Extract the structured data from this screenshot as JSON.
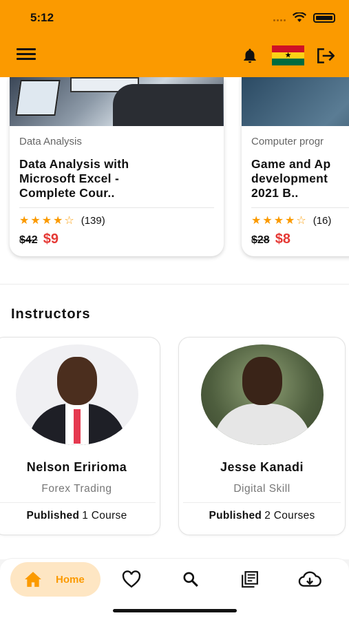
{
  "status_bar": {
    "time": "5:12"
  },
  "colors": {
    "accent": "#fb9a00",
    "price_red": "#e53935",
    "home_pill": "#fee6c3"
  },
  "header": {
    "menu_icon": "hamburger-menu-icon",
    "notification_icon": "bell-icon",
    "flag_icon": "ghana-flag-icon",
    "logout_icon": "logout-icon"
  },
  "courses": [
    {
      "category": "Data Analysis",
      "title_line1": "Data Analysis with",
      "title_line2": "Microsoft Excel -",
      "title_line3": "Complete Cour..",
      "stars": "★★★★☆",
      "rating_value": 4,
      "review_count": "(139)",
      "old_price": "$42",
      "new_price": "$9"
    },
    {
      "category": "Computer progr",
      "title_line1": "Game and Ap",
      "title_line2": "development",
      "title_line3": "2021 B..",
      "stars": "★★★★☆",
      "rating_value": 4,
      "review_count": "(16)",
      "old_price": "$28",
      "new_price": "$8"
    }
  ],
  "instructors_section": {
    "title": "Instructors",
    "items": [
      {
        "name": "Nelson Eririoma",
        "specialty": "Forex Trading",
        "published_label": "Published",
        "course_count": "1 Course"
      },
      {
        "name": "Jesse Kanadi",
        "specialty": "Digital Skill",
        "published_label": "Published",
        "course_count": "2 Courses"
      }
    ]
  },
  "bottom_nav": {
    "home_label": "Home",
    "items": [
      "home-icon",
      "heart-icon",
      "search-icon",
      "library-icon",
      "cloud-download-icon"
    ]
  }
}
